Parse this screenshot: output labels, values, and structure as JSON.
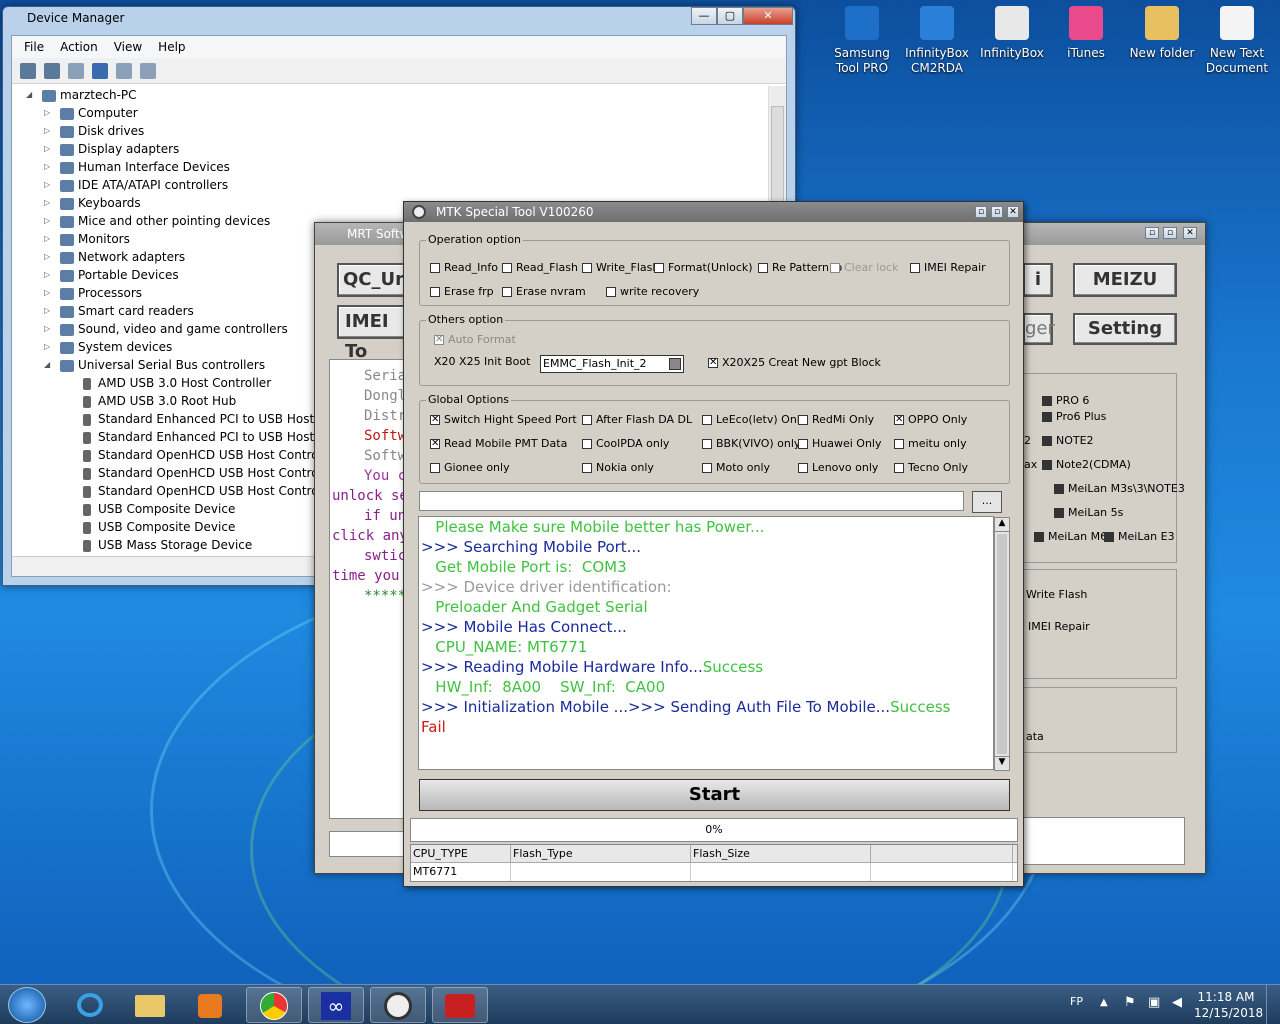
{
  "desktop": {
    "icons": [
      {
        "label": "Samsung Tool PRO",
        "line1": "Samsung",
        "line2": "Tool PRO",
        "color": "#1e6fc8"
      },
      {
        "label": "InfinityBox CM2RDA",
        "line1": "InfinityBox",
        "line2": "CM2RDA",
        "color": "#2a80d8"
      },
      {
        "label": "InfinityBox",
        "line1": "InfinityBox",
        "line2": "",
        "color": "#e8e8e8"
      },
      {
        "label": "iTunes",
        "line1": "iTunes",
        "line2": "",
        "color": "#e84a8c"
      },
      {
        "label": "New folder",
        "line1": "New folder",
        "line2": "",
        "color": "#e8c060"
      },
      {
        "label": "New Text Document",
        "line1": "New Text",
        "line2": "Document",
        "color": "#f4f4f4"
      }
    ]
  },
  "device_manager": {
    "title": "Device Manager",
    "menu": [
      "File",
      "Action",
      "View",
      "Help"
    ],
    "tree": [
      {
        "label": "marztech-PC",
        "level": 0,
        "exp": "◢",
        "icon": "computer-icon"
      },
      {
        "label": "Computer",
        "level": 1,
        "exp": "▷"
      },
      {
        "label": "Disk drives",
        "level": 1,
        "exp": "▷"
      },
      {
        "label": "Display adapters",
        "level": 1,
        "exp": "▷"
      },
      {
        "label": "Human Interface Devices",
        "level": 1,
        "exp": "▷"
      },
      {
        "label": "IDE ATA/ATAPI controllers",
        "level": 1,
        "exp": "▷"
      },
      {
        "label": "Keyboards",
        "level": 1,
        "exp": "▷"
      },
      {
        "label": "Mice and other pointing devices",
        "level": 1,
        "exp": "▷"
      },
      {
        "label": "Monitors",
        "level": 1,
        "exp": "▷"
      },
      {
        "label": "Network adapters",
        "level": 1,
        "exp": "▷"
      },
      {
        "label": "Portable Devices",
        "level": 1,
        "exp": "▷"
      },
      {
        "label": "Processors",
        "level": 1,
        "exp": "▷"
      },
      {
        "label": "Smart card readers",
        "level": 1,
        "exp": "▷"
      },
      {
        "label": "Sound, video and game controllers",
        "level": 1,
        "exp": "▷"
      },
      {
        "label": "System devices",
        "level": 1,
        "exp": "▷"
      },
      {
        "label": "Universal Serial Bus controllers",
        "level": 1,
        "exp": "◢"
      },
      {
        "label": "AMD USB 3.0 Host Controller",
        "level": 2,
        "exp": ""
      },
      {
        "label": "AMD USB 3.0 Root Hub",
        "level": 2,
        "exp": ""
      },
      {
        "label": "Standard Enhanced PCI to USB Host Contr",
        "level": 2,
        "exp": ""
      },
      {
        "label": "Standard Enhanced PCI to USB Host Contr",
        "level": 2,
        "exp": ""
      },
      {
        "label": "Standard OpenHCD USB Host Controller",
        "level": 2,
        "exp": ""
      },
      {
        "label": "Standard OpenHCD USB Host Controller",
        "level": 2,
        "exp": ""
      },
      {
        "label": "Standard OpenHCD USB Host Controller",
        "level": 2,
        "exp": ""
      },
      {
        "label": "USB Composite Device",
        "level": 2,
        "exp": ""
      },
      {
        "label": "USB Composite Device",
        "level": 2,
        "exp": ""
      },
      {
        "label": "USB Mass Storage Device",
        "level": 2,
        "exp": ""
      }
    ]
  },
  "mrt": {
    "title": "MRT Softw",
    "btn_qc": "QC_Un",
    "btn_imei": "IMEI To",
    "btn_i": "i",
    "btn_ger": "ger",
    "btn_meizu": "MEIZU",
    "btn_setting": "Setting",
    "console": [
      "Seria",
      "Dongl",
      "Distr",
      "Softw",
      "Softw",
      "You c",
      "unlock se",
      "if un",
      "click any",
      "swtic",
      "time you",
      "*****"
    ],
    "models": [
      "PRO 6",
      "Pro6 Plus",
      "NOTE2",
      "Note2(CDMA)",
      "MeiLan M3s\\3\\NOTE3",
      "MeiLan 5s",
      "MeiLan M6",
      "MeiLan E3"
    ],
    "frag_2": "2",
    "frag_ax": "ax",
    "write_flash": "Write Flash",
    "imei_repair": "IMEI Repair",
    "ata": "ata"
  },
  "mtk": {
    "title": "MTK Special Tool V100260",
    "operation": {
      "title": "Operation option",
      "items": [
        {
          "label": "Read_Info",
          "checked": false
        },
        {
          "label": "Read_Flash",
          "checked": false
        },
        {
          "label": "Write_Flash",
          "checked": false
        },
        {
          "label": "Format(Unlock)",
          "checked": false
        },
        {
          "label": "Re Pattern lo",
          "checked": false
        },
        {
          "label": "Clear lock",
          "checked": false,
          "disabled": true
        },
        {
          "label": "IMEI Repair",
          "checked": false
        },
        {
          "label": "Erase frp",
          "checked": false
        },
        {
          "label": "Erase nvram",
          "checked": false
        },
        {
          "label": "write recovery",
          "checked": false
        }
      ]
    },
    "others": {
      "title": "Others option",
      "auto_format": "Auto Format",
      "init_boot_label": "X20 X25 Init Boot",
      "init_boot_value": "EMMC_Flash_Init_2",
      "gpt": "X20X25 Creat New gpt Block"
    },
    "global": {
      "title": "Global Options",
      "items": [
        {
          "label": "Switch Hight Speed Port",
          "checked": true
        },
        {
          "label": "After Flash DA DL",
          "checked": false
        },
        {
          "label": "LeEco(letv) Only",
          "checked": false
        },
        {
          "label": "RedMi Only",
          "checked": false
        },
        {
          "label": "OPPO Only",
          "checked": true
        },
        {
          "label": "Read Mobile PMT Data",
          "checked": true
        },
        {
          "label": "CoolPDA only",
          "checked": false
        },
        {
          "label": "BBK(VIVO) only",
          "checked": false
        },
        {
          "label": "Huawei Only",
          "checked": false
        },
        {
          "label": "meitu only",
          "checked": false
        },
        {
          "label": "Gionee only",
          "checked": false
        },
        {
          "label": "Nokia only",
          "checked": false
        },
        {
          "label": "Moto only",
          "checked": false
        },
        {
          "label": "Lenovo only",
          "checked": false
        },
        {
          "label": "Tecno Only",
          "checked": false
        }
      ]
    },
    "browse": "...",
    "log": [
      [
        {
          "t": "   Please Make sure Mobile better has Power...",
          "c": "c-green"
        }
      ],
      [
        {
          "t": ">>> Searching Mobile Port...",
          "c": "c-navy"
        }
      ],
      [
        {
          "t": "   Get Mobile Port is:  COM3",
          "c": "c-green"
        }
      ],
      [
        {
          "t": ">>> Device driver identification:",
          "c": "c-gray"
        }
      ],
      [
        {
          "t": "   Preloader And Gadget Serial",
          "c": "c-green"
        }
      ],
      [
        {
          "t": ">>> Mobile Has Connect...",
          "c": "c-navy"
        }
      ],
      [
        {
          "t": "   CPU_NAME: MT6771",
          "c": "c-green"
        }
      ],
      [
        {
          "t": ">>> Reading Mobile Hardware Info...",
          "c": "c-navy"
        },
        {
          "t": "Success",
          "c": "c-green"
        }
      ],
      [
        {
          "t": "   HW_Inf:  ",
          "c": "c-green"
        },
        {
          "t": "8A00",
          "c": "c-green"
        },
        {
          "t": "    SW_Inf:  ",
          "c": "c-green"
        },
        {
          "t": "CA00",
          "c": "c-green"
        }
      ],
      [
        {
          "t": ">>> Initialization Mobile ...>>> Sending Auth File To Mobile...",
          "c": "c-navy"
        },
        {
          "t": "Success",
          "c": "c-green"
        }
      ],
      [
        {
          "t": "Fail",
          "c": "c-red"
        }
      ]
    ],
    "start": "Start",
    "progress": "0%",
    "table": {
      "headers": [
        "CPU_TYPE",
        "Flash_Type",
        "Flash_Size",
        ""
      ],
      "row": [
        "MT6771",
        "",
        "",
        ""
      ]
    }
  },
  "taskbar": {
    "lang": "FP",
    "time": "11:18 AM",
    "date": "12/15/2018"
  }
}
